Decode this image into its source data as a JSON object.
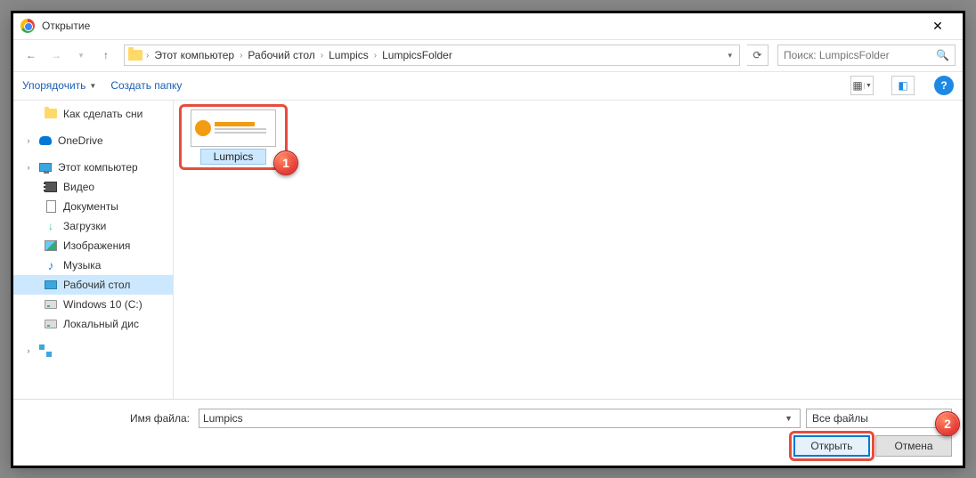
{
  "window": {
    "title": "Открытие"
  },
  "nav": {
    "crumbs": [
      "Этот компьютер",
      "Рабочий стол",
      "Lumpics",
      "LumpicsFolder"
    ],
    "search_placeholder": "Поиск: LumpicsFolder"
  },
  "toolbar": {
    "organize": "Упорядочить",
    "new_folder": "Создать папку"
  },
  "sidebar": {
    "items": [
      {
        "id": "howto",
        "label": "Как сделать сни",
        "icon": "folder",
        "indent": 1
      },
      {
        "id": "onedrive",
        "label": "OneDrive",
        "icon": "onedrive",
        "indent": 0,
        "expandable": true
      },
      {
        "id": "thispc",
        "label": "Этот компьютер",
        "icon": "monitor",
        "indent": 0,
        "expandable": true
      },
      {
        "id": "video",
        "label": "Видео",
        "icon": "video",
        "indent": 1
      },
      {
        "id": "docs",
        "label": "Документы",
        "icon": "doc",
        "indent": 1
      },
      {
        "id": "downloads",
        "label": "Загрузки",
        "icon": "down",
        "indent": 1
      },
      {
        "id": "pictures",
        "label": "Изображения",
        "icon": "pic",
        "indent": 1
      },
      {
        "id": "music",
        "label": "Музыка",
        "icon": "music",
        "indent": 1
      },
      {
        "id": "desktop",
        "label": "Рабочий стол",
        "icon": "desktop",
        "indent": 1,
        "selected": true
      },
      {
        "id": "cdrive",
        "label": "Windows 10 (C:)",
        "icon": "disk",
        "indent": 1
      },
      {
        "id": "localdisk",
        "label": "Локальный дис",
        "icon": "disk",
        "indent": 1
      },
      {
        "id": "network",
        "label": "",
        "icon": "net",
        "indent": 0,
        "expandable": true
      }
    ]
  },
  "content": {
    "file": {
      "name": "Lumpics"
    }
  },
  "footer": {
    "filename_label": "Имя файла:",
    "filename_value": "Lumpics",
    "filter_label": "Все файлы",
    "open": "Открыть",
    "cancel": "Отмена"
  },
  "markers": {
    "m1": "1",
    "m2": "2"
  }
}
